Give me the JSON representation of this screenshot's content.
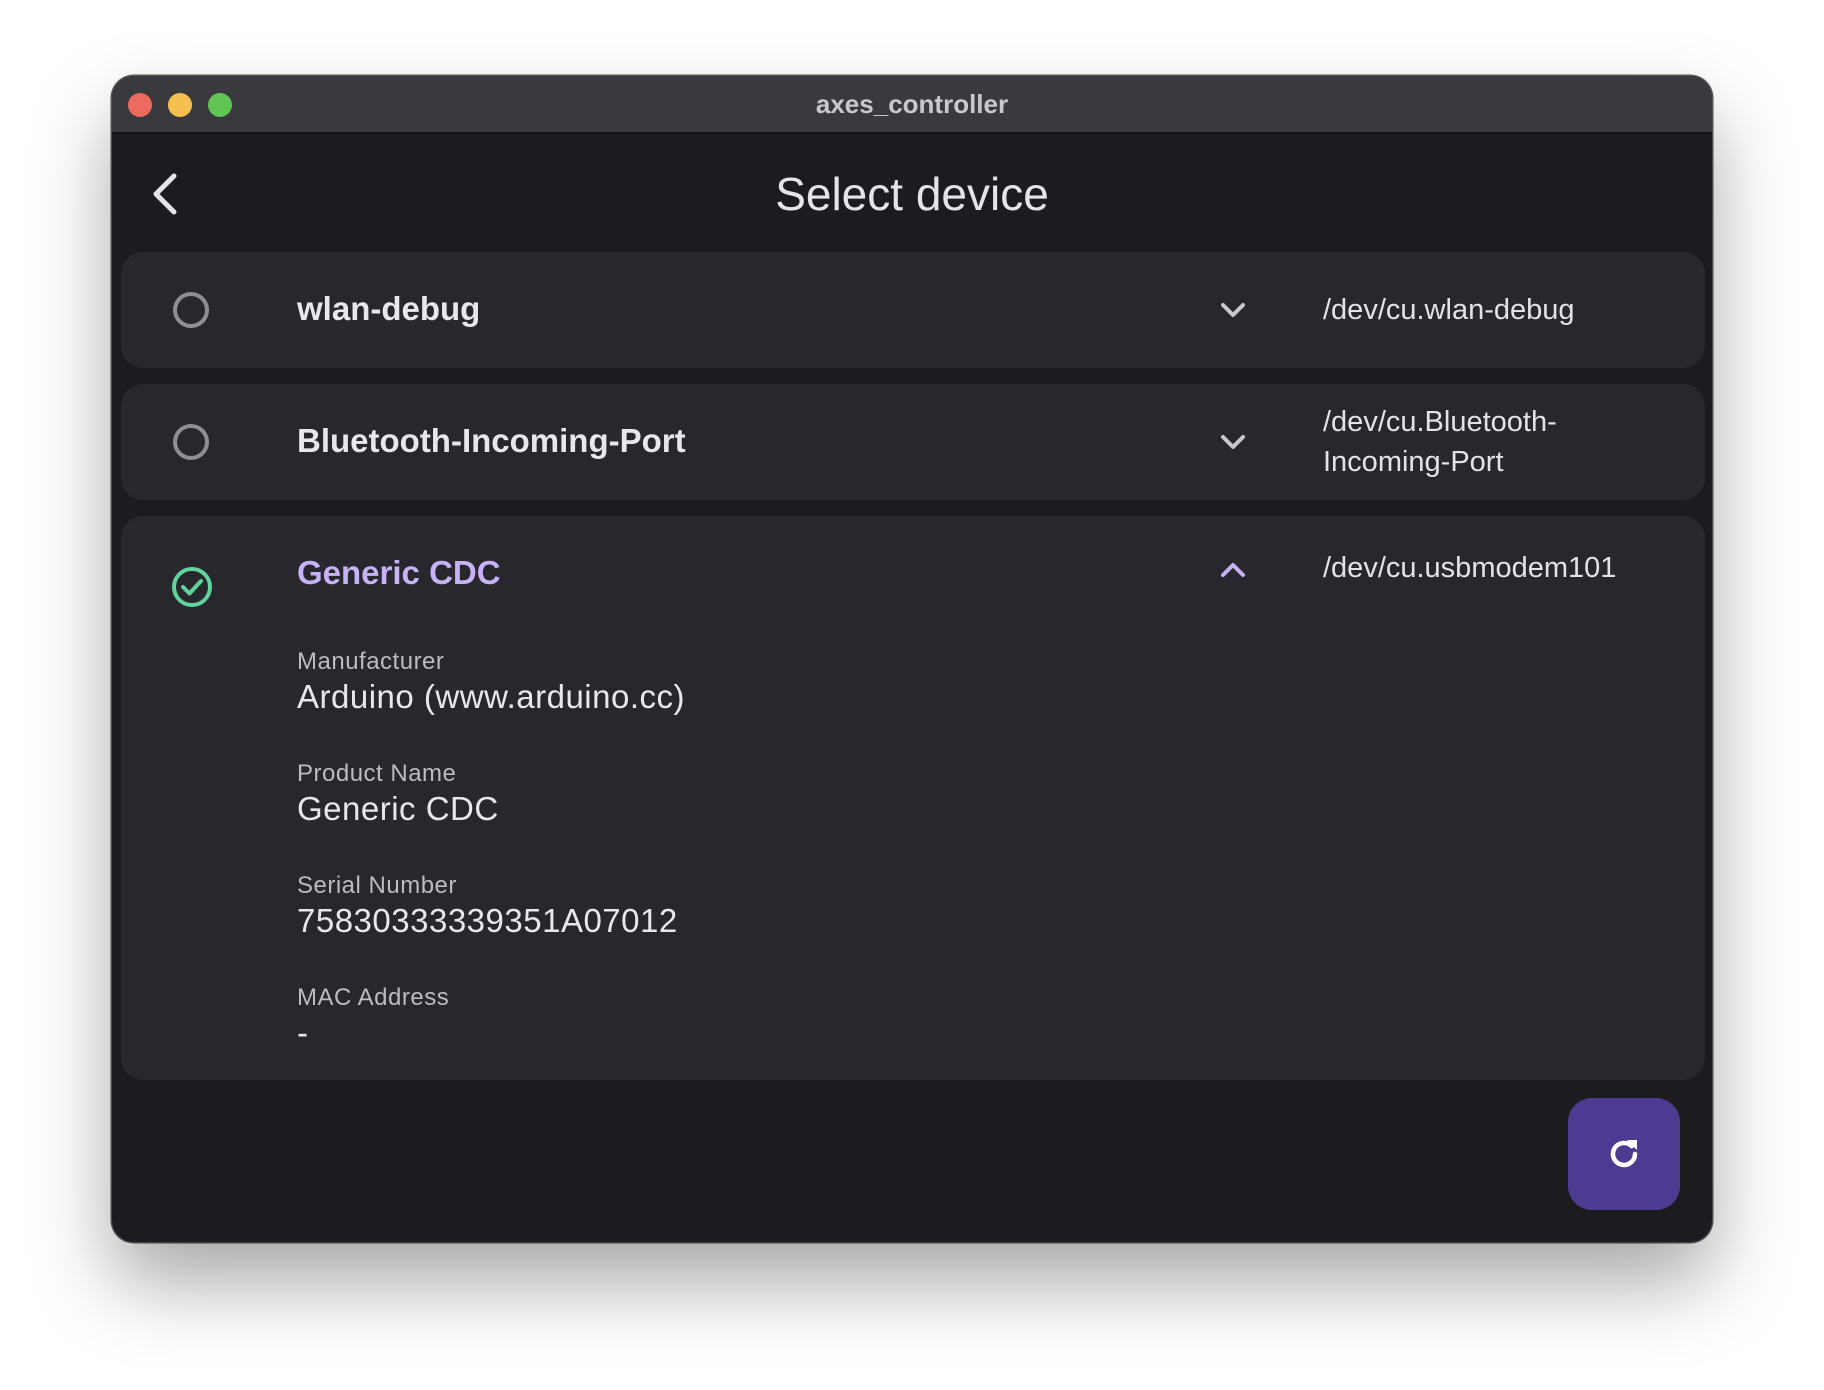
{
  "window": {
    "title": "axes_controller"
  },
  "header": {
    "title": "Select device",
    "back_icon": "chevron-left-icon"
  },
  "devices": [
    {
      "name": "wlan-debug",
      "path": "/dev/cu.wlan-debug",
      "selected": false,
      "expanded": false
    },
    {
      "name": "Bluetooth-Incoming-Port",
      "path_line1": "/dev/cu.Bluetooth-",
      "path_line2": "Incoming-Port",
      "selected": false,
      "expanded": false
    },
    {
      "name": "Generic CDC",
      "path": "/dev/cu.usbmodem101",
      "selected": true,
      "expanded": true,
      "details": {
        "manufacturer_label": "Manufacturer",
        "manufacturer": "Arduino (www.arduino.cc)",
        "product_label": "Product Name",
        "product": "Generic CDC",
        "serial_label": "Serial Number",
        "serial": "75830333339351A07012",
        "mac_label": "MAC Address",
        "mac": "-"
      }
    }
  ],
  "fab": {
    "icon": "refresh-icon"
  },
  "colors": {
    "accent": "#4e3a91",
    "selected_text": "#c5b3f6",
    "check_green": "#5fd39a",
    "background": "#1c1b20",
    "card": "#28272d"
  }
}
